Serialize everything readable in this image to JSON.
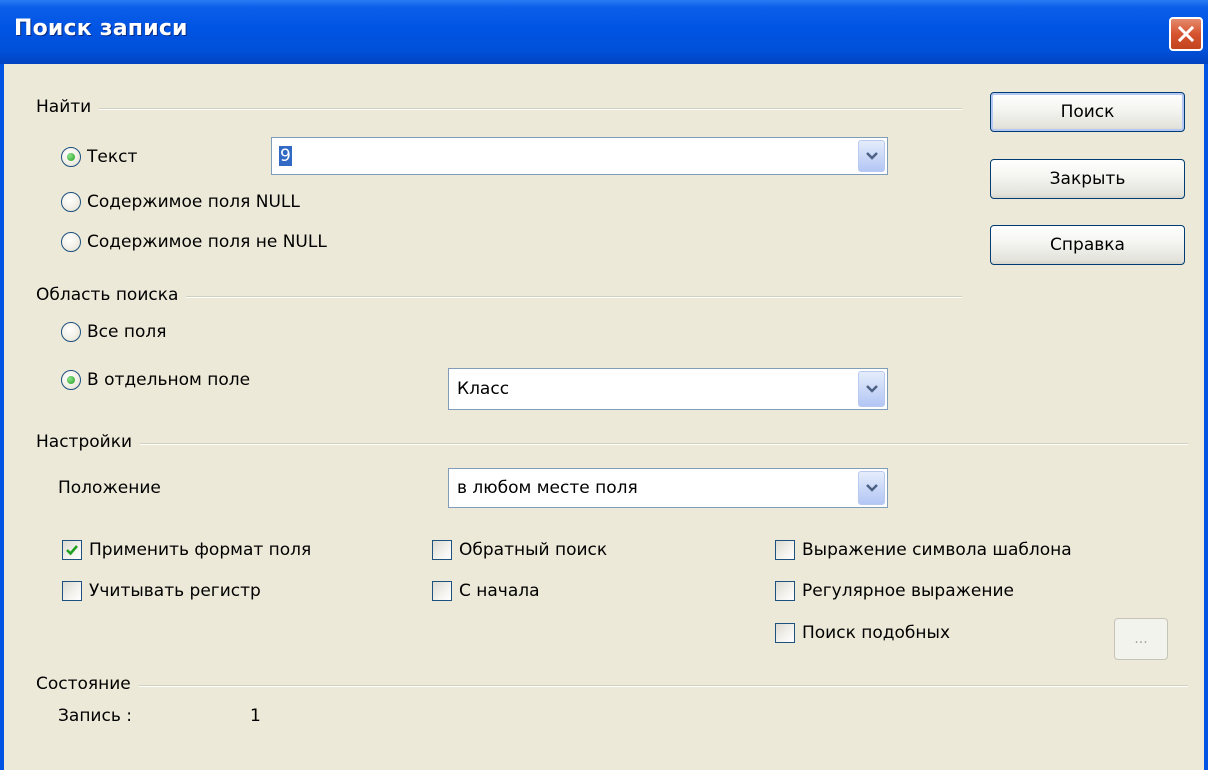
{
  "window": {
    "title": "Поиск записи"
  },
  "find": {
    "group_label": "Найти",
    "radio_text": {
      "label": "Текст",
      "selected": true
    },
    "radio_null": {
      "label": "Содержимое поля NULL",
      "selected": false
    },
    "radio_not_null": {
      "label": "Содержимое поля не NULL",
      "selected": false
    },
    "text_value": "9"
  },
  "scope": {
    "group_label": "Область поиска",
    "all_fields": {
      "label": "Все поля",
      "selected": false
    },
    "single_field": {
      "label": "В отдельном поле",
      "selected": true
    },
    "field_value": "Класс"
  },
  "settings": {
    "group_label": "Настройки",
    "position_label": "Положение",
    "position_value": "в любом месте поля",
    "apply_format": {
      "label": "Применить формат поля",
      "checked": true
    },
    "match_case": {
      "label": "Учитывать регистр",
      "checked": false
    },
    "backwards": {
      "label": "Обратный поиск",
      "checked": false
    },
    "from_start": {
      "label": "С начала",
      "checked": false
    },
    "wildcard": {
      "label": "Выражение символа шаблона",
      "checked": false
    },
    "regex": {
      "label": "Регулярное выражение",
      "checked": false
    },
    "similarity": {
      "label": "Поиск подобных",
      "checked": false
    },
    "similarity_button": "..."
  },
  "status": {
    "group_label": "Состояние",
    "record_label": "Запись :",
    "record_value": "1"
  },
  "buttons": {
    "search": "Поиск",
    "close": "Закрыть",
    "help": "Справка"
  }
}
